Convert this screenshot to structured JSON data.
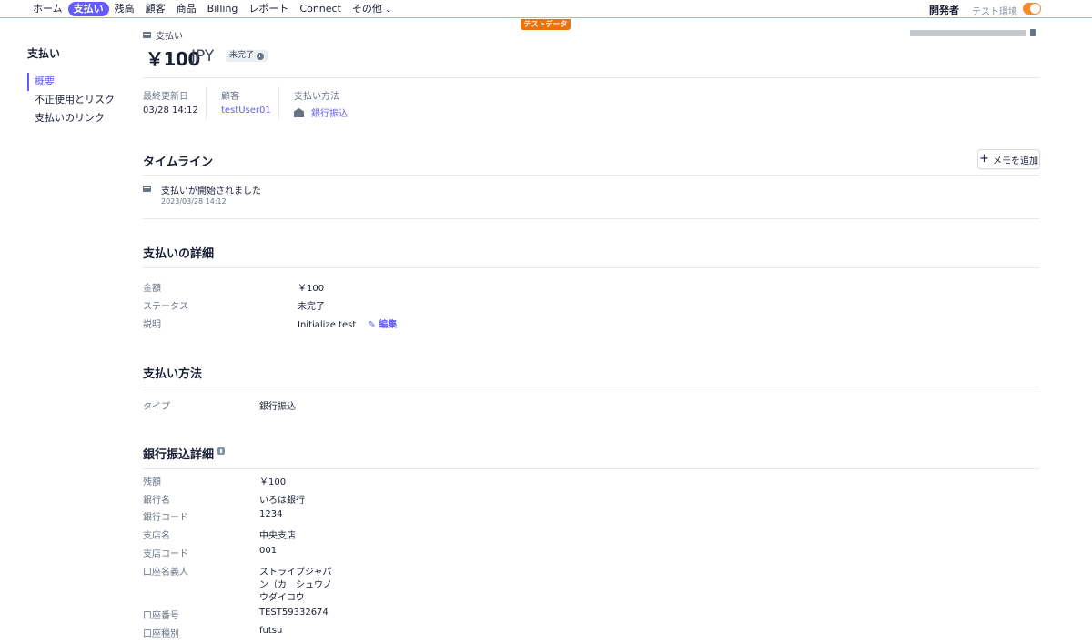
{
  "nav": {
    "items": [
      "ホーム",
      "支払い",
      "残高",
      "顧客",
      "商品",
      "Billing",
      "レポート",
      "Connect",
      "その他"
    ],
    "active_index": 1,
    "developer": "開発者",
    "test_mode": "テスト環境",
    "test_badge": "テストデータ"
  },
  "sidebar": {
    "title": "支払い",
    "items": [
      "概要",
      "不正使用とリスク",
      "支払いのリンク"
    ]
  },
  "header": {
    "breadcrumb": "支払い",
    "amount": "￥100",
    "currency": "JPY",
    "status": "未完了"
  },
  "meta": {
    "updated_label": "最終更新日",
    "updated_value": "03/28 14:12",
    "customer_label": "顧客",
    "customer_value": "testUser01",
    "method_label": "支払い方法",
    "method_value": "銀行振込"
  },
  "timeline": {
    "title": "タイムライン",
    "add_memo": "メモを追加",
    "event_text": "支払いが開始されました",
    "event_date": "2023/03/28 14:12"
  },
  "details": {
    "title": "支払いの詳細",
    "rows": [
      {
        "label": "金額",
        "value": "￥100"
      },
      {
        "label": "ステータス",
        "value": "未完了"
      },
      {
        "label": "説明",
        "value": "Initialize test"
      }
    ],
    "edit": "編集"
  },
  "payment_method": {
    "title": "支払い方法",
    "type_label": "タイプ",
    "type_value": "銀行振込"
  },
  "bank_details": {
    "title": "銀行振込詳細",
    "rows": [
      {
        "label": "残額",
        "value": "￥100"
      },
      {
        "label": "銀行名",
        "value": "いろは銀行"
      },
      {
        "label": "銀行コード",
        "value": "1234"
      },
      {
        "label": "支店名",
        "value": "中央支店"
      },
      {
        "label": "支店コード",
        "value": "001"
      },
      {
        "label": "口座名義人",
        "value_lines": [
          "ストライプジャパ",
          "ン（カ　シュウノ",
          "ウダイコウ"
        ]
      },
      {
        "label": "口座番号",
        "value": "TEST59332674"
      },
      {
        "label": "口座種別",
        "value": "futsu"
      }
    ]
  },
  "colors": {
    "accent": "#635bff",
    "test_orange": "#e8730f"
  }
}
